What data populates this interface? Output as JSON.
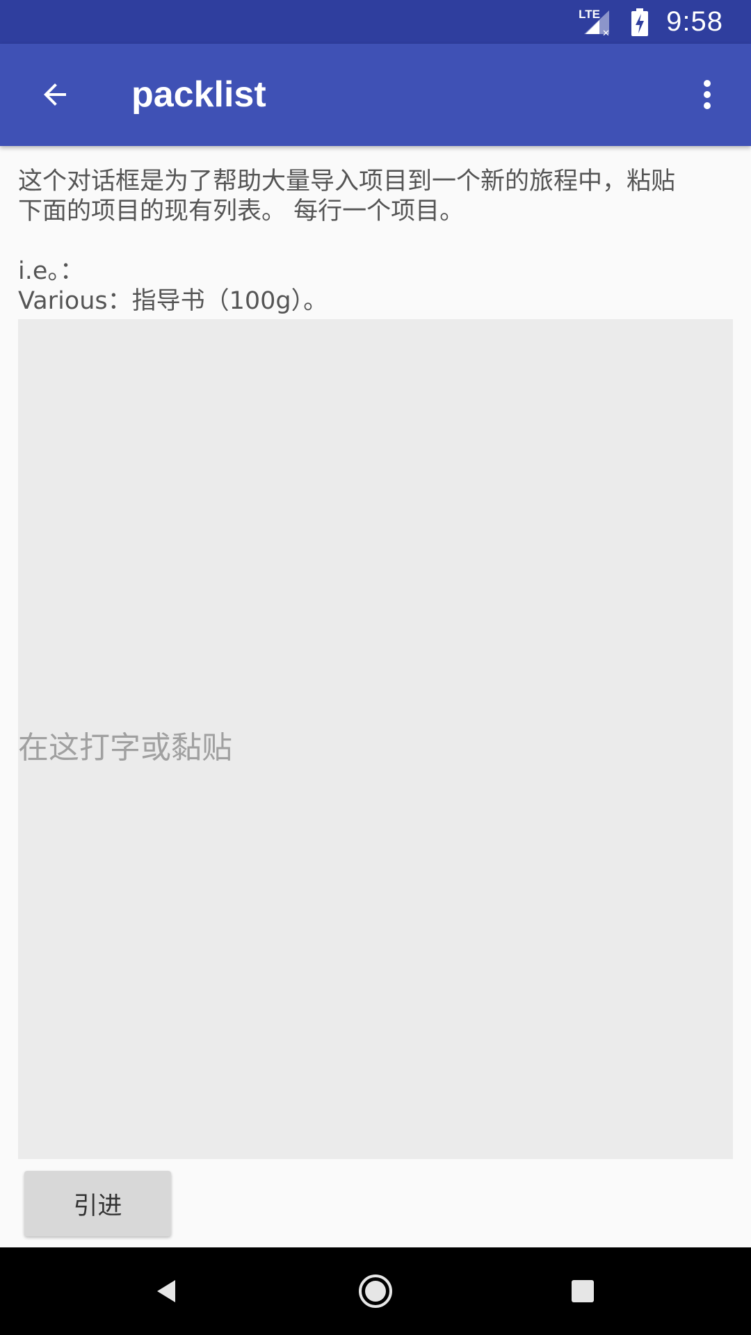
{
  "status_bar": {
    "network": "LTE",
    "time": "9:58"
  },
  "app_bar": {
    "title": "packlist",
    "back_icon": "arrow-back-icon",
    "overflow_icon": "more-vert-icon"
  },
  "main": {
    "instructions": "这个对话框是为了帮助大量导入项目到一个新的旅程中，粘贴\n下面的项目的现有列表。 每行一个项目。\n\ni.e。：\nVarious：指导书（100g）。",
    "textarea_value": "",
    "textarea_placeholder": "在这打字或黏贴",
    "import_button_label": "引进"
  },
  "nav_bar": {
    "back_icon": "nav-back-icon",
    "home_icon": "nav-home-icon",
    "recents_icon": "nav-recents-icon"
  },
  "colors": {
    "status_bar": "#2f3e9e",
    "app_bar": "#3f51b5",
    "background": "#fafafa",
    "textarea_bg": "#ebebeb",
    "button_bg": "#d8d8d8"
  }
}
